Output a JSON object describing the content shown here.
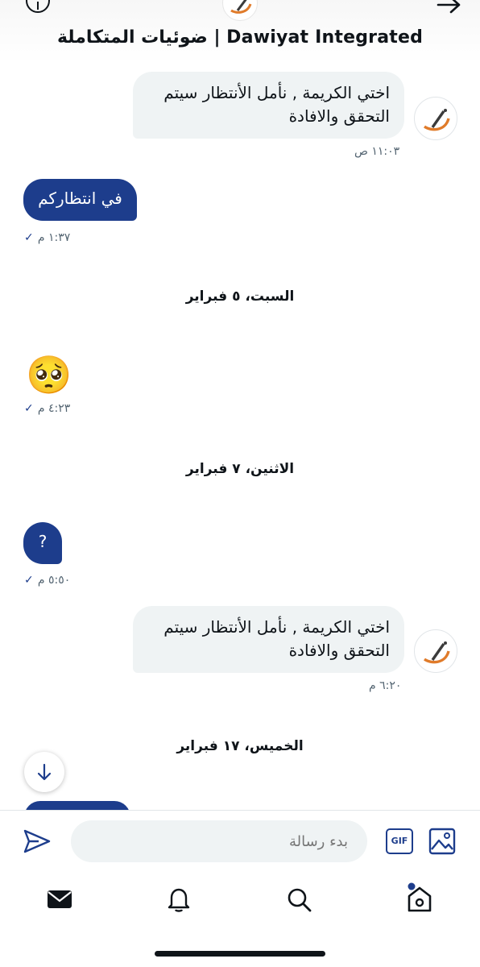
{
  "header": {
    "title": "ضوئيات المتكاملة | Dawiyat Integrated"
  },
  "messages": [
    {
      "type": "incoming",
      "lines": [
        "اختي الكريمة , نأمل الأنتظار سيتم",
        "التحقق والافادة"
      ],
      "time": "١١:٠٣ ص"
    },
    {
      "type": "outgoing",
      "text": "في انتظاركم",
      "time": "١:٣٧ م"
    },
    {
      "type": "date",
      "label": "السبت، ٥ فبراير"
    },
    {
      "type": "outgoing-emoji",
      "text": "🥺",
      "time": "٤:٢٣ م"
    },
    {
      "type": "date",
      "label": "الاثنين، ٧ فبراير"
    },
    {
      "type": "outgoing",
      "text": "?",
      "time": "٥:٥٠ م"
    },
    {
      "type": "incoming",
      "lines": [
        "اختي الكريمة , نأمل الأنتظار سيتم",
        "التحقق والافادة"
      ],
      "time": "٦:٢٠ م"
    },
    {
      "type": "date",
      "label": "الخميس، ١٧ فبراير"
    }
  ],
  "check_mark": "✓",
  "composer": {
    "placeholder": "بدء رسالة",
    "gif_label": "GIF"
  },
  "icons": {
    "info": "info-icon",
    "back": "arrow-right-icon",
    "send": "send-icon",
    "image": "image-icon",
    "scroll": "arrow-down-icon",
    "tabs": [
      "mail-icon",
      "bell-icon",
      "search-icon",
      "home-icon"
    ]
  },
  "colors": {
    "accent": "#1d3d8c",
    "incoming_bubble": "#eff3f4",
    "muted_text": "#536471"
  }
}
